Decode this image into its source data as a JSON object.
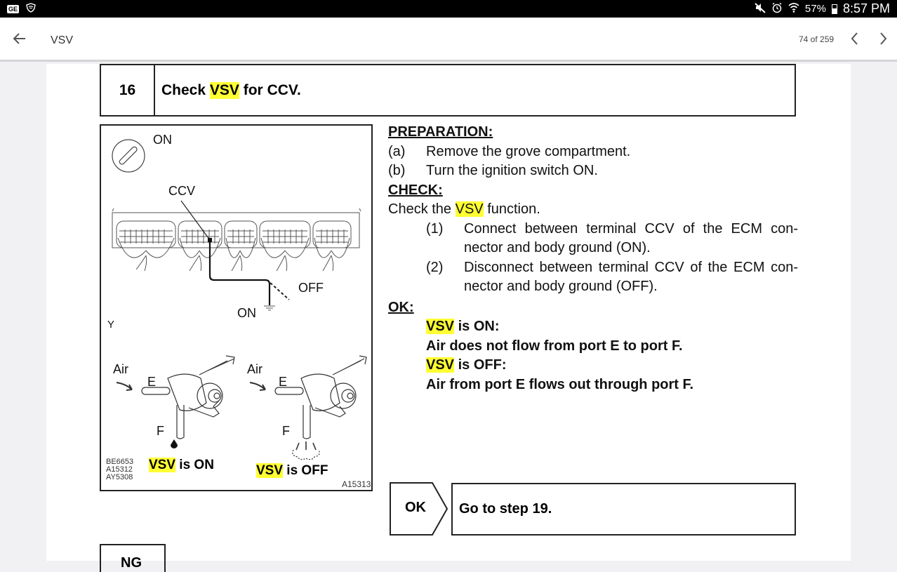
{
  "status_bar": {
    "left_icons": [
      "ge-notification-icon",
      "shield-wifi-icon"
    ],
    "ge_badge": "GE",
    "right_icons": [
      "mute-icon",
      "alarm-icon",
      "wifi-icon"
    ],
    "battery_percent": "57%",
    "battery_level": 0.57,
    "time": "8:57 PM"
  },
  "app_bar": {
    "back_icon": "arrow-left-icon",
    "title": "VSV",
    "page_count": "74 of 259",
    "prev_icon": "chevron-left-icon",
    "next_icon": "chevron-right-icon"
  },
  "document": {
    "step": {
      "number": "16",
      "title_prefix": "Check ",
      "title_highlight": "VSV",
      "title_suffix": " for CCV."
    },
    "figure": {
      "ignition_label": "ON",
      "ccv_label": "CCV",
      "off_label": "OFF",
      "on_label": "ON",
      "y_label": "Y",
      "left_air": "Air",
      "left_e": "E",
      "left_f": "F",
      "right_air": "Air",
      "right_e": "E",
      "right_f": "F",
      "ref_codes": [
        "BE6653",
        "A15312",
        "AY5308"
      ],
      "caption_on_highlight": "VSV",
      "caption_on_suffix": " is ON",
      "caption_off_highlight": "VSV",
      "caption_off_suffix": " is OFF",
      "figure_code": "A15313"
    },
    "preparation": {
      "heading": "PREPARATION:",
      "items": [
        {
          "label": "(a)",
          "text": "Remove the grove compartment."
        },
        {
          "label": "(b)",
          "text": "Turn the ignition switch ON."
        }
      ]
    },
    "check": {
      "heading": "CHECK:",
      "intro_prefix": "Check the ",
      "intro_highlight": "VSV",
      "intro_suffix": " function.",
      "items": [
        {
          "label": "(1)",
          "text": "Connect between terminal CCV of the ECM con-nector and body ground (ON)."
        },
        {
          "label": "(2)",
          "text": "Disconnect between terminal CCV of the ECM con-nector and body ground (OFF)."
        }
      ]
    },
    "ok": {
      "heading": "OK:",
      "on_highlight": "VSV",
      "on_suffix": " is ON:",
      "on_text": "Air does not flow from port E to port F.",
      "off_highlight": "VSV",
      "off_suffix": " is OFF:",
      "off_text": "Air from port E flows out through port F."
    },
    "result_ok": {
      "tag": "OK",
      "text": "Go to step 19."
    },
    "result_ng": {
      "tag": "NG"
    }
  },
  "colors": {
    "highlight": "#ffff33",
    "status_bar_bg": "#000000",
    "page_bg": "#ffffff",
    "viewer_bg": "#f1f1f3"
  }
}
